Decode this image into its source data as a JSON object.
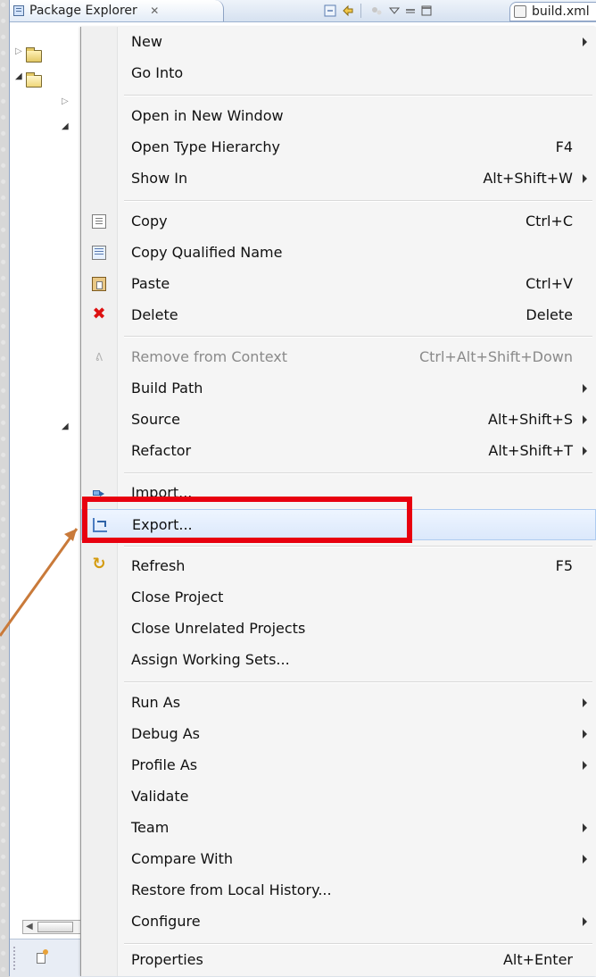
{
  "window": {
    "tab_title": "Package Explorer",
    "tab_close": "✕",
    "build_tab": "build.xml"
  },
  "icons": {
    "tab": "package-explorer-icon",
    "toolbar": [
      "collapse-all-icon",
      "link-with-editor-icon",
      "focus-icon",
      "view-menu-icon",
      "minimize-icon",
      "maximize-icon"
    ],
    "tree": [
      "java-project-icon",
      "java-project-open-icon"
    ],
    "status": "new-item-icon"
  },
  "tree": {
    "twisties": [
      "▷",
      "◢",
      "▷",
      "◢",
      "◢"
    ]
  },
  "menu": {
    "items": [
      {
        "label": "New",
        "accel": "",
        "submenu": true
      },
      {
        "label": "Go Into",
        "accel": "",
        "submenu": false
      },
      {
        "label": "Open in New Window",
        "accel": "",
        "submenu": false
      },
      {
        "label": "Open Type Hierarchy",
        "accel": "F4",
        "submenu": false
      },
      {
        "label": "Show In",
        "accel": "Alt+Shift+W",
        "submenu": true
      },
      {
        "label": "Copy",
        "accel": "Ctrl+C",
        "submenu": false,
        "icon": "copy-icon"
      },
      {
        "label": "Copy Qualified Name",
        "accel": "",
        "submenu": false,
        "icon": "copy-qualified-name-icon"
      },
      {
        "label": "Paste",
        "accel": "Ctrl+V",
        "submenu": false,
        "icon": "paste-icon"
      },
      {
        "label": "Delete",
        "accel": "Delete",
        "submenu": false,
        "icon": "delete-icon"
      },
      {
        "label": "Remove from Context",
        "accel": "Ctrl+Alt+Shift+Down",
        "submenu": false,
        "disabled": true,
        "icon": "remove-from-context-icon"
      },
      {
        "label": "Build Path",
        "accel": "",
        "submenu": true
      },
      {
        "label": "Source",
        "accel": "Alt+Shift+S",
        "submenu": true
      },
      {
        "label": "Refactor",
        "accel": "Alt+Shift+T",
        "submenu": true
      },
      {
        "label": "Import...",
        "accel": "",
        "submenu": false,
        "icon": "import-icon"
      },
      {
        "label": "Export...",
        "accel": "",
        "submenu": false,
        "icon": "export-icon",
        "highlighted": true
      },
      {
        "label": "Refresh",
        "accel": "F5",
        "submenu": false,
        "icon": "refresh-icon"
      },
      {
        "label": "Close Project",
        "accel": "",
        "submenu": false
      },
      {
        "label": "Close Unrelated Projects",
        "accel": "",
        "submenu": false
      },
      {
        "label": "Assign Working Sets...",
        "accel": "",
        "submenu": false
      },
      {
        "label": "Run As",
        "accel": "",
        "submenu": true
      },
      {
        "label": "Debug As",
        "accel": "",
        "submenu": true
      },
      {
        "label": "Profile As",
        "accel": "",
        "submenu": true
      },
      {
        "label": "Validate",
        "accel": "",
        "submenu": false
      },
      {
        "label": "Team",
        "accel": "",
        "submenu": true
      },
      {
        "label": "Compare With",
        "accel": "",
        "submenu": true
      },
      {
        "label": "Restore from Local History...",
        "accel": "",
        "submenu": false
      },
      {
        "label": "Configure",
        "accel": "",
        "submenu": true
      },
      {
        "label": "Properties",
        "accel": "Alt+Enter",
        "submenu": false
      }
    ]
  },
  "colors": {
    "annotation_red": "#e8000f",
    "annotation_arrow": "#c97a3a",
    "highlight_border": "#aecbf0",
    "delete_red": "#dd1111",
    "refresh_orange": "#d49b0f"
  }
}
